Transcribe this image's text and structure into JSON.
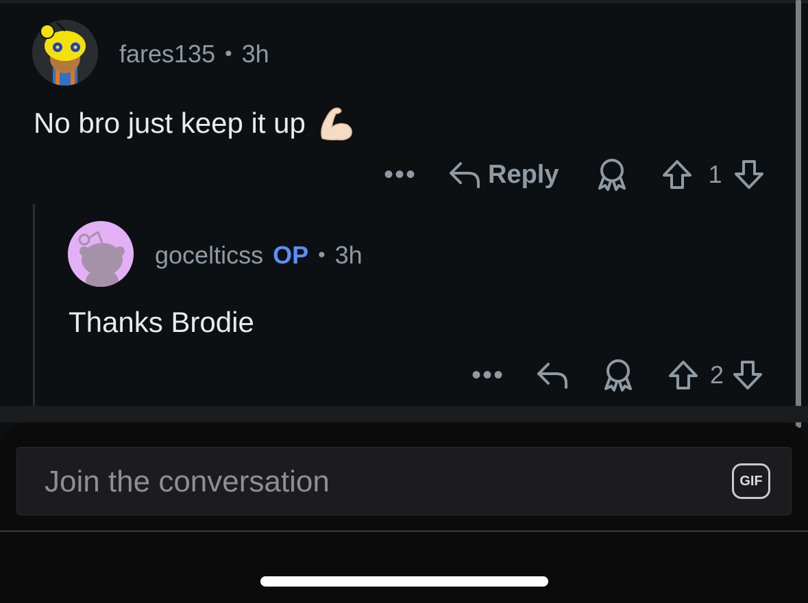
{
  "comments": [
    {
      "username": "fares135",
      "separator": "•",
      "time": "3h",
      "text": "No bro just keep it up",
      "emoji": "💪",
      "more_label": "•••",
      "reply_label": "Reply",
      "score": "1",
      "avatar_icon": "snoo-bearded-yellow-avatar"
    },
    {
      "username": "gocelticss",
      "op_badge": "OP",
      "separator": "•",
      "time": "3h",
      "text": "Thanks Brodie",
      "more_label": "•••",
      "score": "2",
      "avatar_icon": "snoo-default-avatar"
    }
  ],
  "composer": {
    "placeholder": "Join the conversation",
    "gif_label": "GIF"
  },
  "colors": {
    "background": "#0d1013",
    "meta_text": "#8f9aa3",
    "op_badge": "#5b8ff5",
    "avatar1_bg": "#2a2d30",
    "avatar2_bg": "#e3b0f5"
  }
}
